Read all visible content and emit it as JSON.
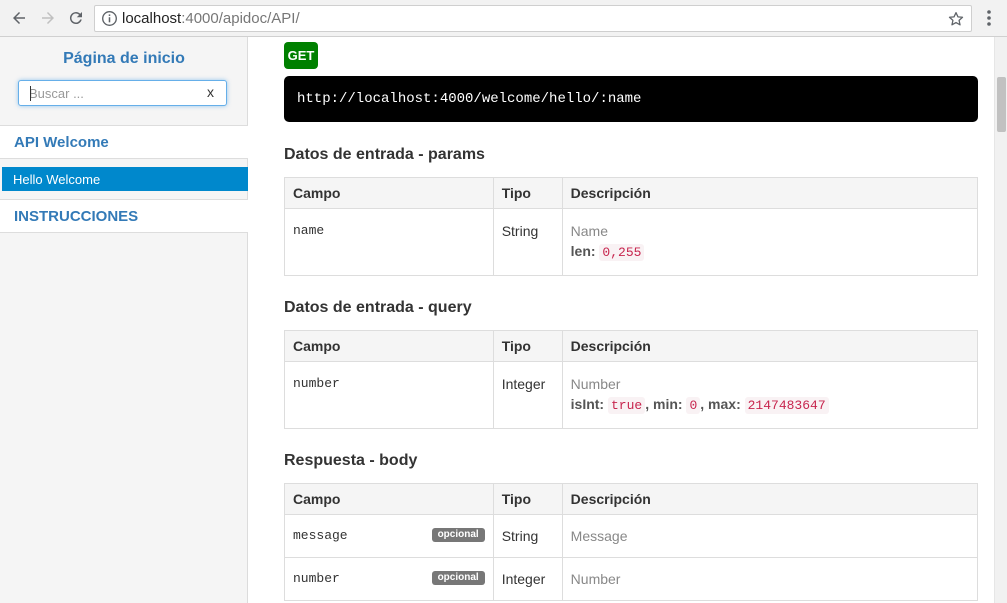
{
  "browser": {
    "url_host": "localhost",
    "url_rest": ":4000/apidoc/API/"
  },
  "sidebar": {
    "home_link": "Página de inicio",
    "search_placeholder": "Buscar ...",
    "search_clear": "x",
    "groups": [
      {
        "label": "API Welcome"
      },
      {
        "label": "INSTRUCCIONES"
      }
    ],
    "active_item": "Hello Welcome"
  },
  "endpoint": {
    "method": "GET",
    "method_color": "#008000",
    "url": "http://localhost:4000/welcome/hello/:name"
  },
  "headers": {
    "campo": "Campo",
    "tipo": "Tipo",
    "descripcion": "Descripción"
  },
  "params": {
    "title": "Datos de entrada - params",
    "rows": [
      {
        "campo": "name",
        "tipo": "String",
        "desc": "Name",
        "meta_label": "len:",
        "meta_value": "0,255"
      }
    ]
  },
  "query": {
    "title": "Datos de entrada - query",
    "rows": [
      {
        "campo": "number",
        "tipo": "Integer",
        "desc": "Number",
        "isint_label": "isInt:",
        "isint_value": "true",
        "sep1": ",",
        "min_label": "min:",
        "min_value": "0",
        "sep2": ",",
        "max_label": "max:",
        "max_value": "2147483647"
      }
    ]
  },
  "body": {
    "title": "Respuesta - body",
    "rows": [
      {
        "campo": "message",
        "badge": "opcional",
        "tipo": "String",
        "desc": "Message"
      },
      {
        "campo": "number",
        "badge": "opcional",
        "tipo": "Integer",
        "desc": "Number"
      }
    ]
  },
  "colors": {
    "link": "#337ab7",
    "active": "#0088cc",
    "code": "#c7254e"
  }
}
